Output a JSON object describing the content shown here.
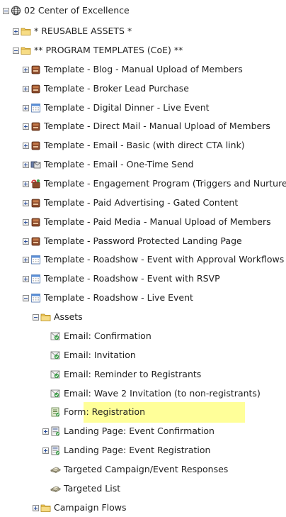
{
  "tree": {
    "root": {
      "label": "02 Center of Excellence",
      "icon": "globe-icon"
    },
    "reusable": {
      "label": "* REUSABLE ASSETS *",
      "icon": "folder-icon"
    },
    "program_templates": {
      "label": "** PROGRAM TEMPLATES (CoE) **",
      "icon": "folder-icon"
    },
    "templates": [
      {
        "label": "Template - Blog - Manual Upload of Members",
        "icon": "program-box-icon"
      },
      {
        "label": "Template - Broker Lead Purchase",
        "icon": "program-box-icon"
      },
      {
        "label": "Template - Digital Dinner - Live Event",
        "icon": "event-calendar-icon"
      },
      {
        "label": "Template - Direct Mail - Manual Upload of Members",
        "icon": "program-box-icon"
      },
      {
        "label": "Template - Email - Basic (with direct CTA link)",
        "icon": "program-box-icon"
      },
      {
        "label": "Template - Email - One-Time Send",
        "icon": "email-program-icon"
      },
      {
        "label": "Template - Engagement Program (Triggers and Nurture)",
        "icon": "engagement-program-icon"
      },
      {
        "label": "Template - Paid Advertising - Gated Content",
        "icon": "program-box-icon"
      },
      {
        "label": "Template - Paid Media - Manual Upload of Members",
        "icon": "program-box-icon"
      },
      {
        "label": "Template - Password Protected Landing Page",
        "icon": "program-box-icon"
      },
      {
        "label": "Template - Roadshow - Event with Approval Workflows",
        "icon": "event-calendar-icon"
      },
      {
        "label": "Template - Roadshow - Event with RSVP",
        "icon": "event-calendar-icon"
      },
      {
        "label": "Template - Roadshow - Live Event",
        "icon": "event-calendar-icon"
      }
    ],
    "assets_folder": {
      "label": "Assets",
      "icon": "folder-icon"
    },
    "assets": [
      {
        "label": "Email: Confirmation",
        "icon": "email-asset-icon"
      },
      {
        "label": "Email: Invitation",
        "icon": "email-asset-icon"
      },
      {
        "label": "Email: Reminder to Registrants",
        "icon": "email-asset-icon"
      },
      {
        "label": "Email: Wave 2 Invitation (to non-registrants)",
        "icon": "email-asset-icon"
      },
      {
        "label": "Form: Registration",
        "icon": "form-icon",
        "highlighted": true
      },
      {
        "label": "Landing Page: Event Confirmation",
        "icon": "landing-page-icon"
      },
      {
        "label": "Landing Page: Event Registration",
        "icon": "landing-page-icon"
      },
      {
        "label": "Targeted Campaign/Event Responses",
        "icon": "list-icon"
      },
      {
        "label": "Targeted List",
        "icon": "list-icon"
      }
    ],
    "campaign_flows": {
      "label": "Campaign Flows",
      "icon": "folder-icon"
    }
  },
  "colors": {
    "highlight": "#ffff99",
    "folder": "#f2c95a",
    "program_box": "#8b4a2b",
    "calendar_header": "#5b8fd6",
    "email_asset": "#3f9e4b",
    "text": "#1f1f1f"
  }
}
